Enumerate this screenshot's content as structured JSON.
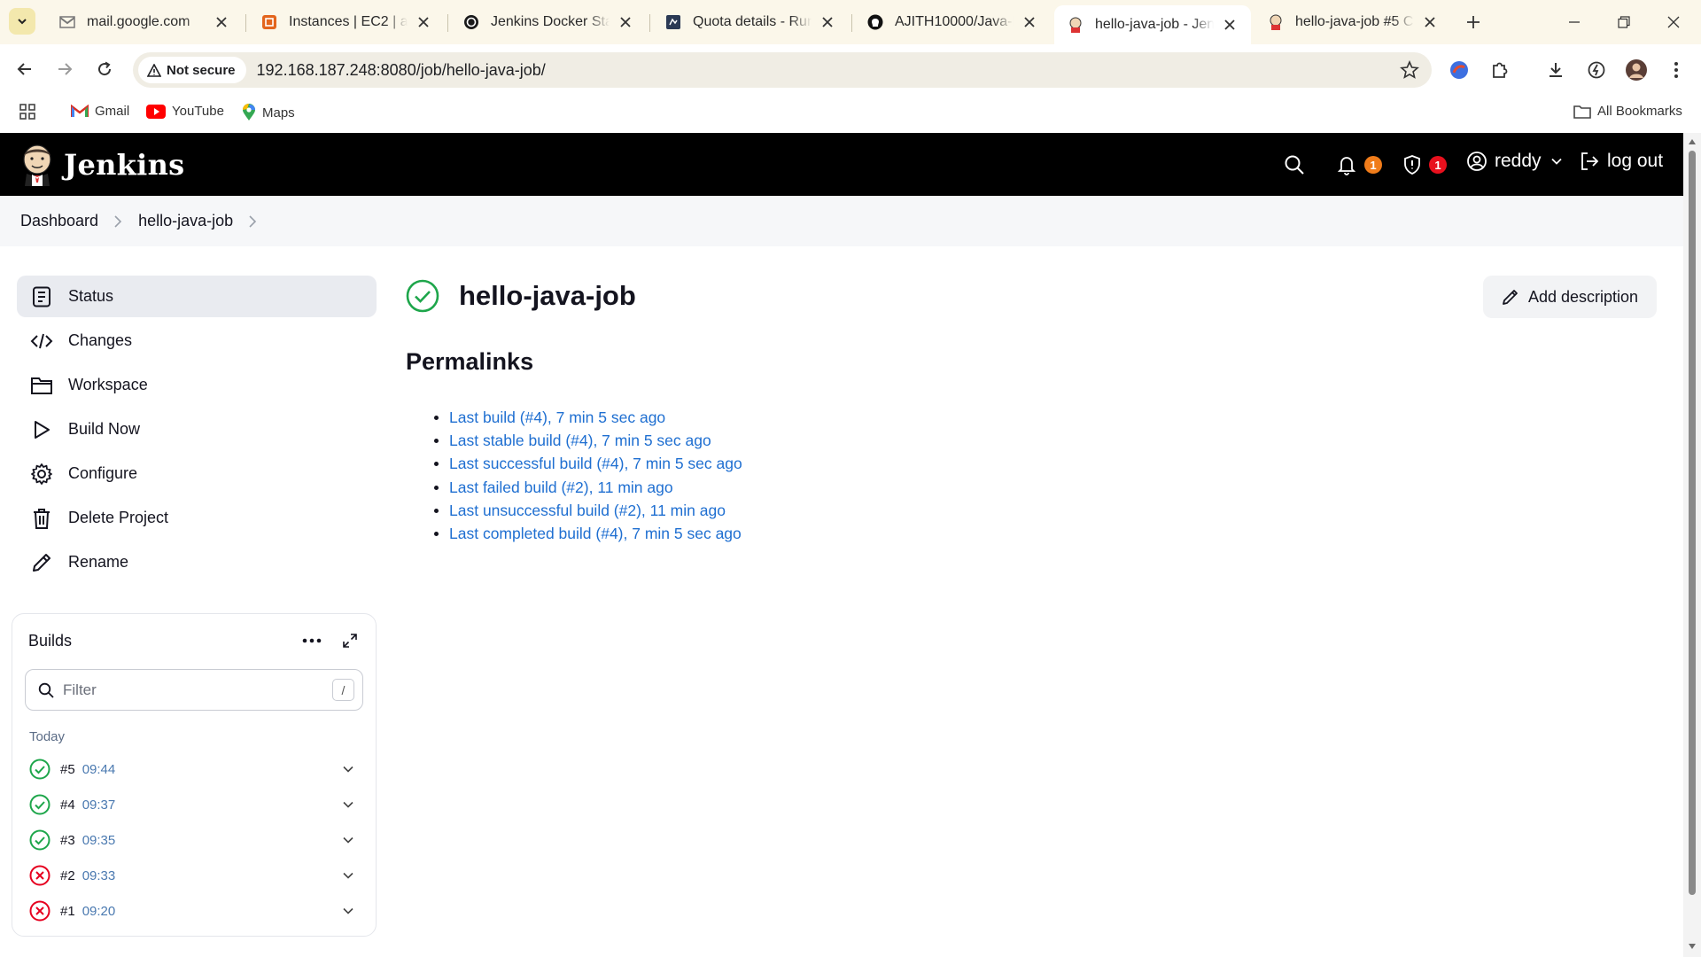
{
  "browser": {
    "tabs": [
      {
        "title": "mail.google.com",
        "icon": "gmail-icon"
      },
      {
        "title": "Instances | EC2 | ap-s",
        "icon": "aws-icon"
      },
      {
        "title": "Jenkins Docker Startu",
        "icon": "chatgpt-icon"
      },
      {
        "title": "Quota details - Runn",
        "icon": "quota-icon"
      },
      {
        "title": "AJITH10000/Java-Ma",
        "icon": "github-icon"
      },
      {
        "title": "hello-java-job - Jenk",
        "icon": "jenkins-icon",
        "active": true
      },
      {
        "title": "hello-java-job #5 Co",
        "icon": "jenkins-icon"
      }
    ],
    "security_chip": "Not secure",
    "url": "192.168.187.248:8080/job/hello-java-job/",
    "bookmarks": [
      {
        "label": "Gmail",
        "icon": "gmail-icon"
      },
      {
        "label": "YouTube",
        "icon": "youtube-icon"
      },
      {
        "label": "Maps",
        "icon": "maps-icon"
      }
    ],
    "all_bookmarks": "All Bookmarks"
  },
  "header": {
    "brand": "Jenkins",
    "notifications_count": "1",
    "security_count": "1",
    "user": "reddy",
    "logout": "log out",
    "colors": {
      "bar": "#000000",
      "notif_badge": "#f07c1a",
      "security_badge": "#e8101d"
    }
  },
  "breadcrumb": {
    "items": [
      "Dashboard",
      "hello-java-job"
    ]
  },
  "sidebar": {
    "items": [
      {
        "label": "Status",
        "icon": "status-icon",
        "active": true
      },
      {
        "label": "Changes",
        "icon": "code-icon"
      },
      {
        "label": "Workspace",
        "icon": "folder-icon"
      },
      {
        "label": "Build Now",
        "icon": "play-icon"
      },
      {
        "label": "Configure",
        "icon": "gear-icon"
      },
      {
        "label": "Delete Project",
        "icon": "trash-icon"
      },
      {
        "label": "Rename",
        "icon": "pencil-icon"
      }
    ]
  },
  "builds": {
    "title": "Builds",
    "filter_placeholder": "Filter",
    "filter_shortcut": "/",
    "group_label": "Today",
    "items": [
      {
        "number": "#5",
        "time": "09:44",
        "status": "success"
      },
      {
        "number": "#4",
        "time": "09:37",
        "status": "success"
      },
      {
        "number": "#3",
        "time": "09:35",
        "status": "success"
      },
      {
        "number": "#2",
        "time": "09:33",
        "status": "failed"
      },
      {
        "number": "#1",
        "time": "09:20",
        "status": "failed"
      }
    ],
    "colors": {
      "success": "#1ea64b",
      "failed": "#e6001f"
    }
  },
  "main": {
    "job_title": "hello-java-job",
    "job_status": "success",
    "add_description": "Add description",
    "permalinks_title": "Permalinks",
    "permalinks": [
      "Last build (#4), 7 min 5 sec ago",
      "Last stable build (#4), 7 min 5 sec ago",
      "Last successful build (#4), 7 min 5 sec ago",
      "Last failed build (#2), 11 min ago",
      "Last unsuccessful build (#2), 11 min ago",
      "Last completed build (#4), 7 min 5 sec ago"
    ]
  }
}
